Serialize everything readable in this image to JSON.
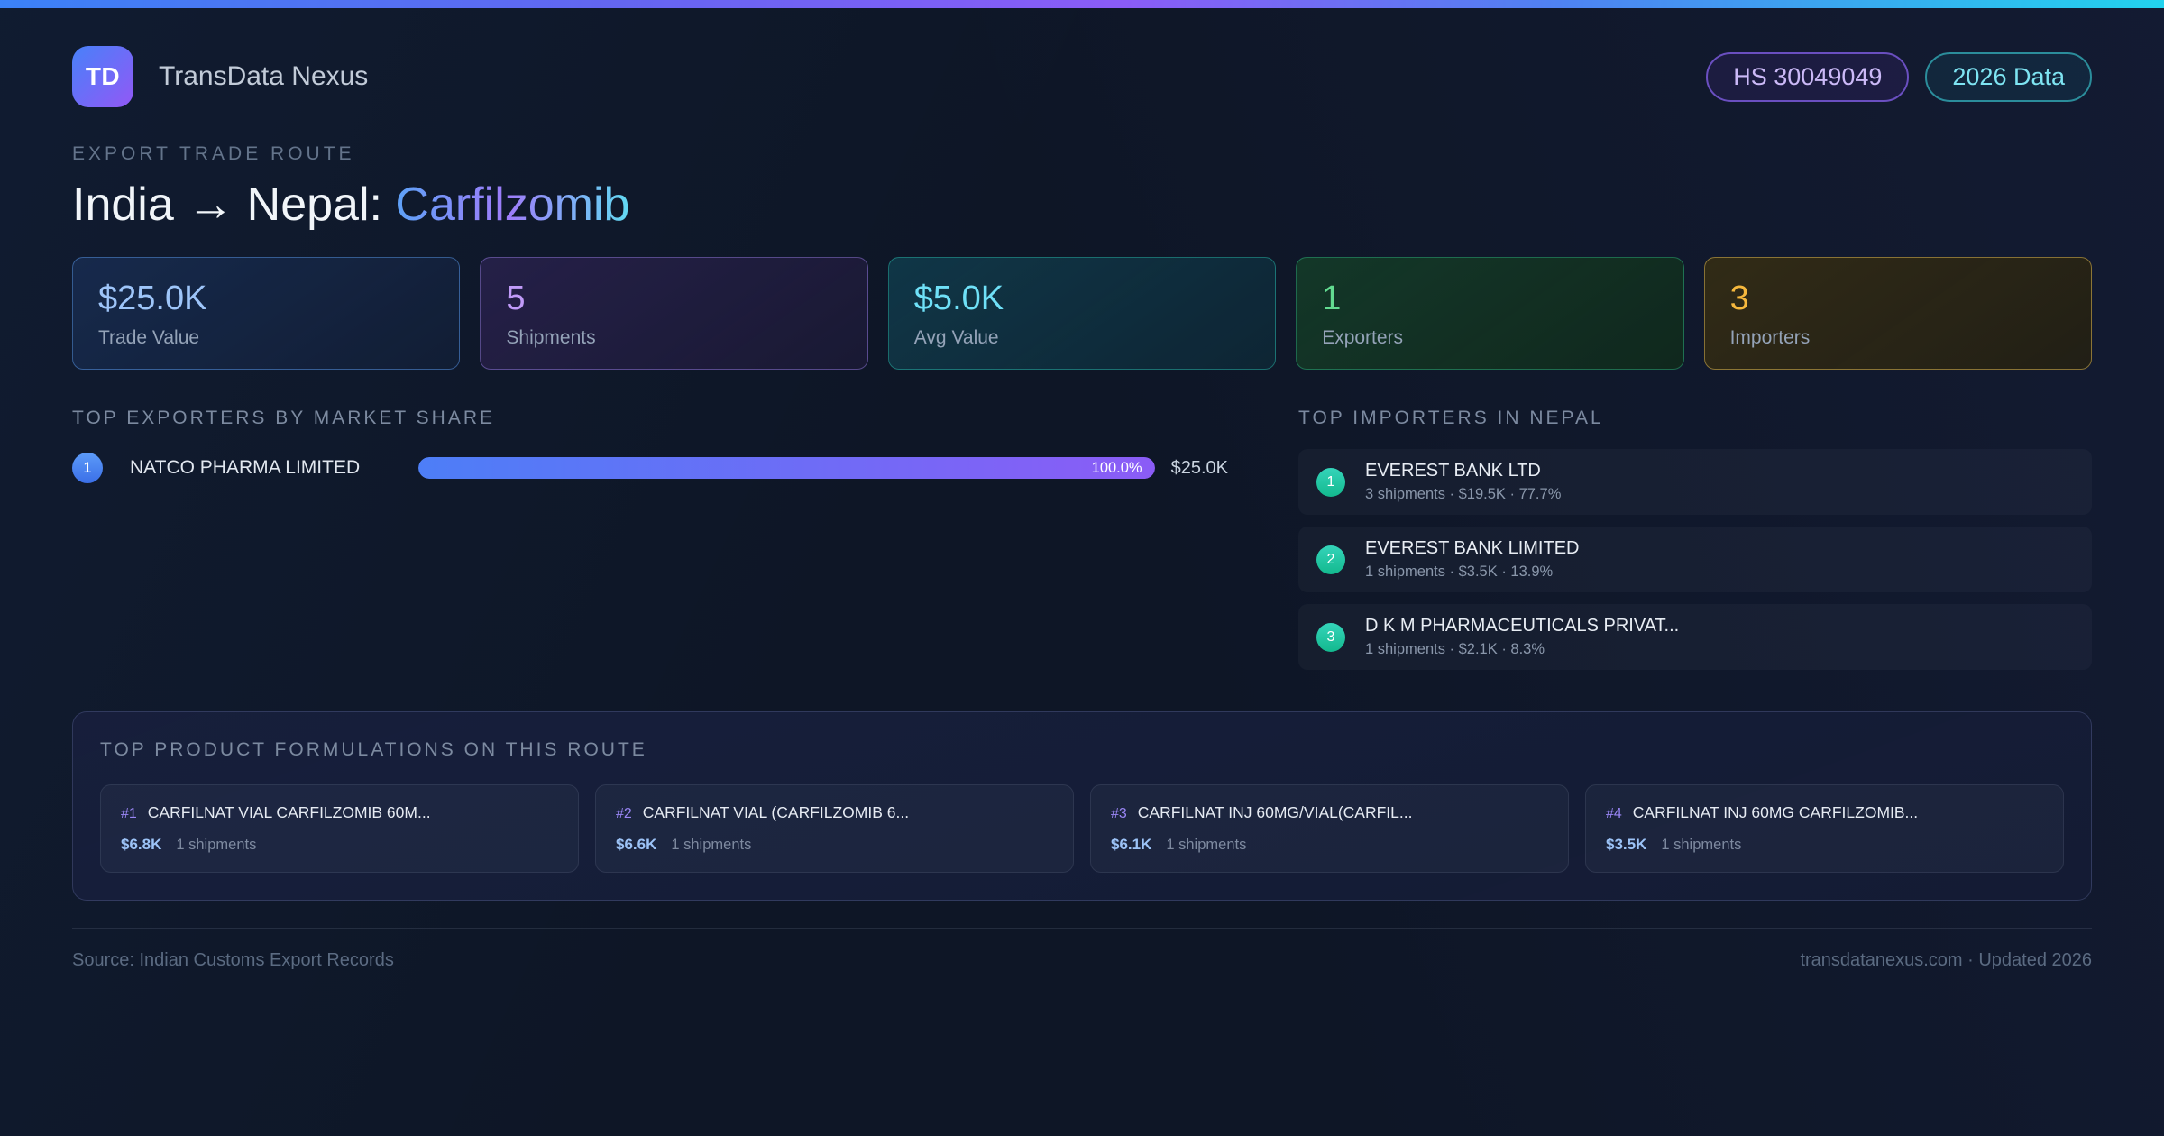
{
  "app": {
    "logo": "TD",
    "name": "TransData Nexus"
  },
  "header_badges": {
    "hs_code": "HS 30049049",
    "data_year": "2026 Data"
  },
  "hero": {
    "eyebrow": "EXPORT TRADE ROUTE",
    "route": "India → Nepal: ",
    "product": "Carfilzomib"
  },
  "stats": [
    {
      "value": "$25.0K",
      "label": "Trade Value"
    },
    {
      "value": "5",
      "label": "Shipments"
    },
    {
      "value": "$5.0K",
      "label": "Avg Value"
    },
    {
      "value": "1",
      "label": "Exporters"
    },
    {
      "value": "3",
      "label": "Importers"
    }
  ],
  "exporters": {
    "title": "TOP EXPORTERS BY MARKET SHARE",
    "items": [
      {
        "rank": "1",
        "name": "NATCO PHARMA LIMITED",
        "share_label": "100.0%",
        "share_pct": 100,
        "value": "$25.0K"
      }
    ]
  },
  "importers": {
    "title": "TOP IMPORTERS IN NEPAL",
    "items": [
      {
        "rank": "1",
        "name": "EVEREST BANK LTD",
        "meta": "3 shipments · $19.5K · 77.7%"
      },
      {
        "rank": "2",
        "name": "EVEREST BANK LIMITED",
        "meta": "1 shipments · $3.5K · 13.9%"
      },
      {
        "rank": "3",
        "name": "D K M PHARMACEUTICALS PRIVAT...",
        "meta": "1 shipments · $2.1K · 8.3%"
      }
    ]
  },
  "formulations": {
    "title": "TOP PRODUCT FORMULATIONS ON THIS ROUTE",
    "items": [
      {
        "rank": "#1",
        "name": "CARFILNAT VIAL CARFILZOMIB 60M...",
        "value": "$6.8K",
        "shipments": "1 shipments"
      },
      {
        "rank": "#2",
        "name": "CARFILNAT VIAL (CARFILZOMIB 6...",
        "value": "$6.6K",
        "shipments": "1 shipments"
      },
      {
        "rank": "#3",
        "name": "CARFILNAT INJ 60MG/VIAL(CARFIL...",
        "value": "$6.1K",
        "shipments": "1 shipments"
      },
      {
        "rank": "#4",
        "name": "CARFILNAT INJ 60MG CARFILZOMIB...",
        "value": "$3.5K",
        "shipments": "1 shipments"
      }
    ]
  },
  "footer": {
    "source": "Source: Indian Customs Export Records",
    "updated": "transdatanexus.com · Updated 2026"
  },
  "colors": {
    "accent_blue": "#3b82f6",
    "accent_purple": "#8b5cf6",
    "accent_cyan": "#22d3ee",
    "stat_trade_value": "#9ec5f9",
    "stat_shipments": "#c19bf9",
    "stat_avg_value": "#6fe0f7",
    "stat_exporters": "#62db90",
    "stat_importers": "#f6b83d",
    "importer_rank": "#14b98e",
    "badge_hs_border": "#6a4fc0",
    "badge_year_border": "#2b8d9b",
    "page_background": "#0e1626"
  }
}
